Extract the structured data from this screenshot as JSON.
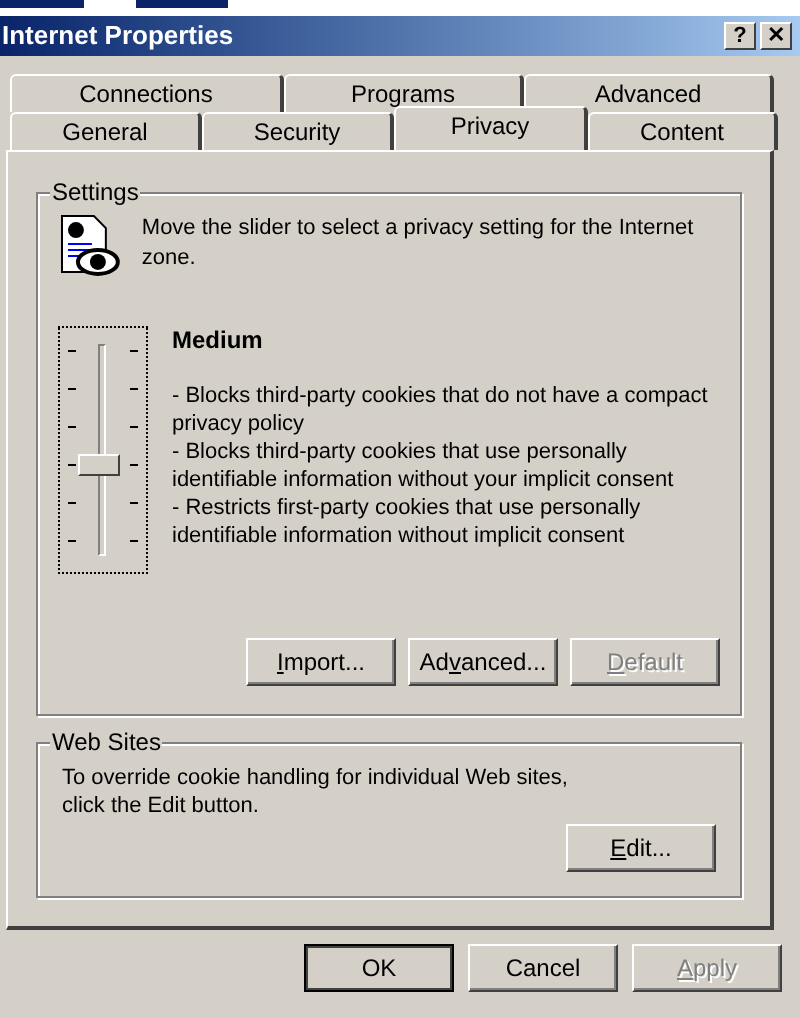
{
  "window": {
    "title": "Internet Properties",
    "title_buttons": [
      {
        "kind": "help",
        "label": "?"
      },
      {
        "kind": "close",
        "label": "✕"
      }
    ]
  },
  "tab_rows": [
    [
      {
        "label": "Connections",
        "selected": false
      },
      {
        "label": "Programs",
        "selected": false
      },
      {
        "label": "Advanced",
        "selected": false
      }
    ],
    [
      {
        "label": "General",
        "selected": false
      },
      {
        "label": "Security",
        "selected": false
      },
      {
        "label": "Privacy",
        "selected": true
      },
      {
        "label": "Content",
        "selected": false
      }
    ]
  ],
  "settings": {
    "title": "Settings",
    "intro": "Move the slider to select a privacy setting for the Internet zone.",
    "slider": {
      "level": 0.4
    },
    "level_name": "Medium",
    "description": [
      "- Blocks third-party cookies that do not have a compact privacy policy",
      "- Blocks third-party cookies that use personally identifiable information without your implicit consent",
      "- Restricts first-party cookies that use personally identifiable information without implicit consent"
    ],
    "buttons": [
      {
        "key": "I",
        "after": "mport...",
        "disabled": false
      },
      {
        "before": "Ad",
        "key": "v",
        "after": "anced...",
        "disabled": false
      },
      {
        "key": "D",
        "after": "efault",
        "disabled": true
      }
    ]
  },
  "web_sites": {
    "title": "Web Sites",
    "text": "To override cookie handling for individual Web sites, click the Edit button.",
    "button": {
      "key": "E",
      "after": "dit...",
      "disabled": false
    }
  },
  "dialog_buttons": [
    {
      "before": "OK",
      "disabled": false,
      "default": true
    },
    {
      "before": "Cancel",
      "disabled": false,
      "default": false
    },
    {
      "key": "A",
      "after": "pply",
      "disabled": true,
      "default": false
    }
  ]
}
